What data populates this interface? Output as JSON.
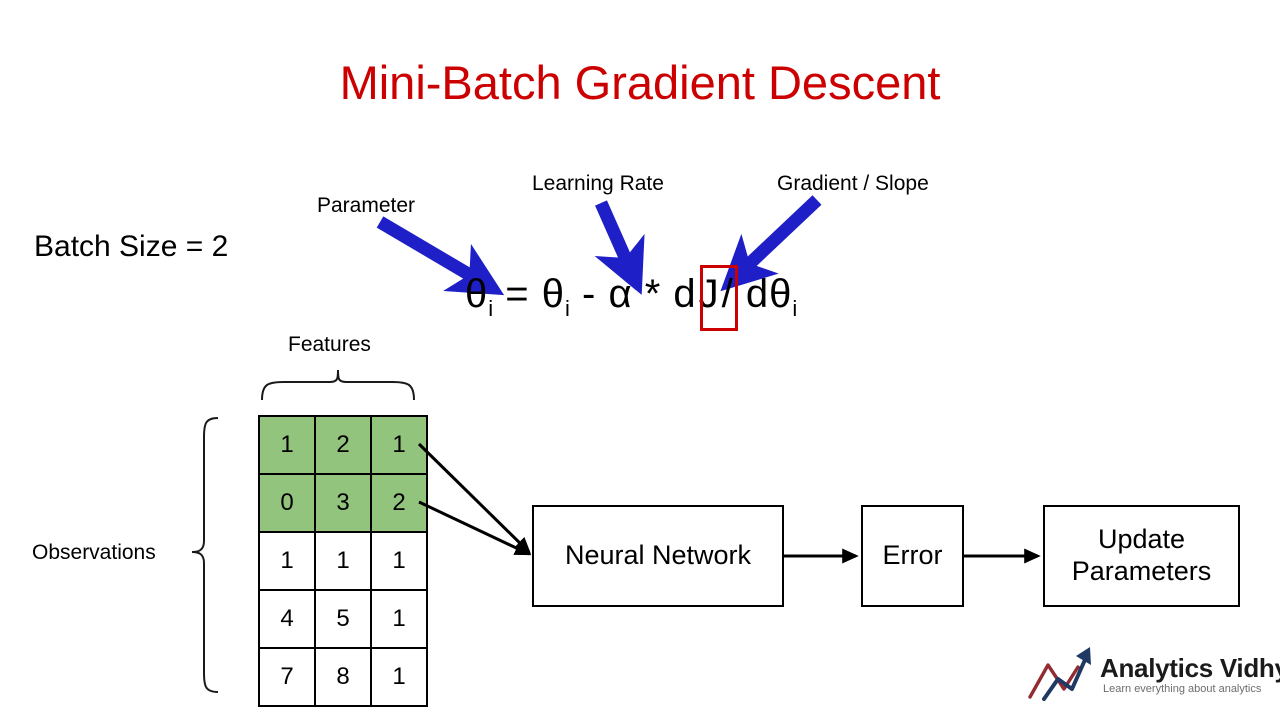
{
  "slide": {
    "title": "Mini-Batch Gradient Descent",
    "title_color": "#cc0000",
    "background": "#ffffff"
  },
  "batch": {
    "label": "Batch Size = 2"
  },
  "callouts": {
    "parameter": "Parameter",
    "learning_rate": "Learning Rate",
    "gradient": "Gradient / Slope",
    "arrow_color": "#1f1fc8"
  },
  "formula": {
    "theta": "θ",
    "subscript": "i",
    "equals": "=",
    "minus": "-",
    "alpha": "α",
    "times": "*",
    "d1": "d",
    "numerator": "J",
    "divide": "/",
    "d2": "d",
    "full_text": "θi = θi - α * dJ / dθi",
    "highlight_color": "#cc0000"
  },
  "table": {
    "features_label": "Features",
    "observations_label": "Observations",
    "highlight_color": "#93c47d",
    "rows": [
      {
        "cells": [
          "1",
          "2",
          "1"
        ],
        "highlighted": true
      },
      {
        "cells": [
          "0",
          "3",
          "2"
        ],
        "highlighted": true
      },
      {
        "cells": [
          "1",
          "1",
          "1"
        ],
        "highlighted": false
      },
      {
        "cells": [
          "4",
          "5",
          "1"
        ],
        "highlighted": false
      },
      {
        "cells": [
          "7",
          "8",
          "1"
        ],
        "highlighted": false
      }
    ]
  },
  "flow": {
    "neural_network": "Neural Network",
    "error": "Error",
    "update_parameters": "Update\nParameters",
    "update_parameters_line1": "Update",
    "update_parameters_line2": "Parameters"
  },
  "logo": {
    "name": "Analytics Vidhya",
    "tagline": "Learn everything about analytics",
    "mark_arrow_color": "#1f3864",
    "mark_line_color": "#922b32"
  }
}
